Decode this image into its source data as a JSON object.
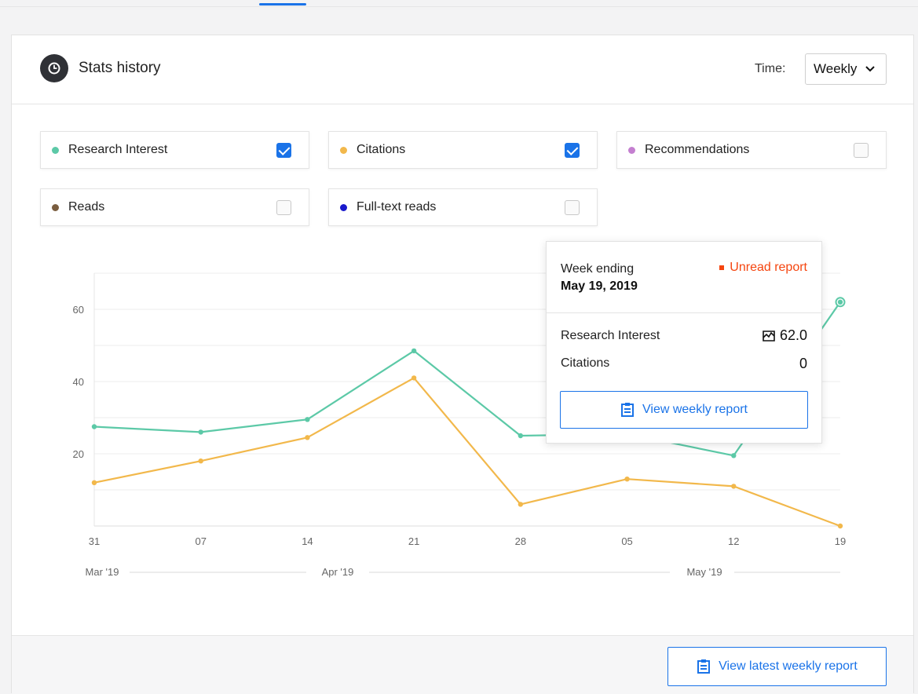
{
  "header": {
    "title": "Stats history",
    "time_label": "Time:",
    "time_value": "Weekly",
    "icon": "clock-icon"
  },
  "filters": [
    {
      "label": "Research Interest",
      "color": "#5cc9a7",
      "checked": true
    },
    {
      "label": "Citations",
      "color": "#f2b84b",
      "checked": true
    },
    {
      "label": "Recommendations",
      "color": "#c47fd0",
      "checked": false
    },
    {
      "label": "Reads",
      "color": "#7a5d3f",
      "checked": false
    },
    {
      "label": "Full-text reads",
      "color": "#1a1acc",
      "checked": false
    }
  ],
  "chart_data": {
    "type": "line",
    "x": [
      "31",
      "07",
      "14",
      "21",
      "28",
      "05",
      "12",
      "19"
    ],
    "month_labels": [
      "Mar '19",
      "Apr '19",
      "May '19"
    ],
    "y_ticks": [
      20,
      40,
      60
    ],
    "ylim": [
      0,
      70
    ],
    "grid": true,
    "series": [
      {
        "name": "Research Interest",
        "color": "#5cc9a7",
        "values": [
          27.5,
          26,
          29.5,
          48.5,
          25,
          25.5,
          19.5,
          62
        ]
      },
      {
        "name": "Citations",
        "color": "#f2b84b",
        "values": [
          12,
          18,
          24.5,
          41,
          6,
          13,
          11,
          0
        ]
      }
    ]
  },
  "popup": {
    "week_label": "Week ending",
    "week_date": "May 19, 2019",
    "unread": "Unread report",
    "rows": [
      {
        "label": "Research Interest",
        "value": "62.0",
        "icon": "research-interest-icon"
      },
      {
        "label": "Citations",
        "value": "0"
      }
    ],
    "button": "View weekly report"
  },
  "footer": {
    "button": "View latest weekly report"
  }
}
